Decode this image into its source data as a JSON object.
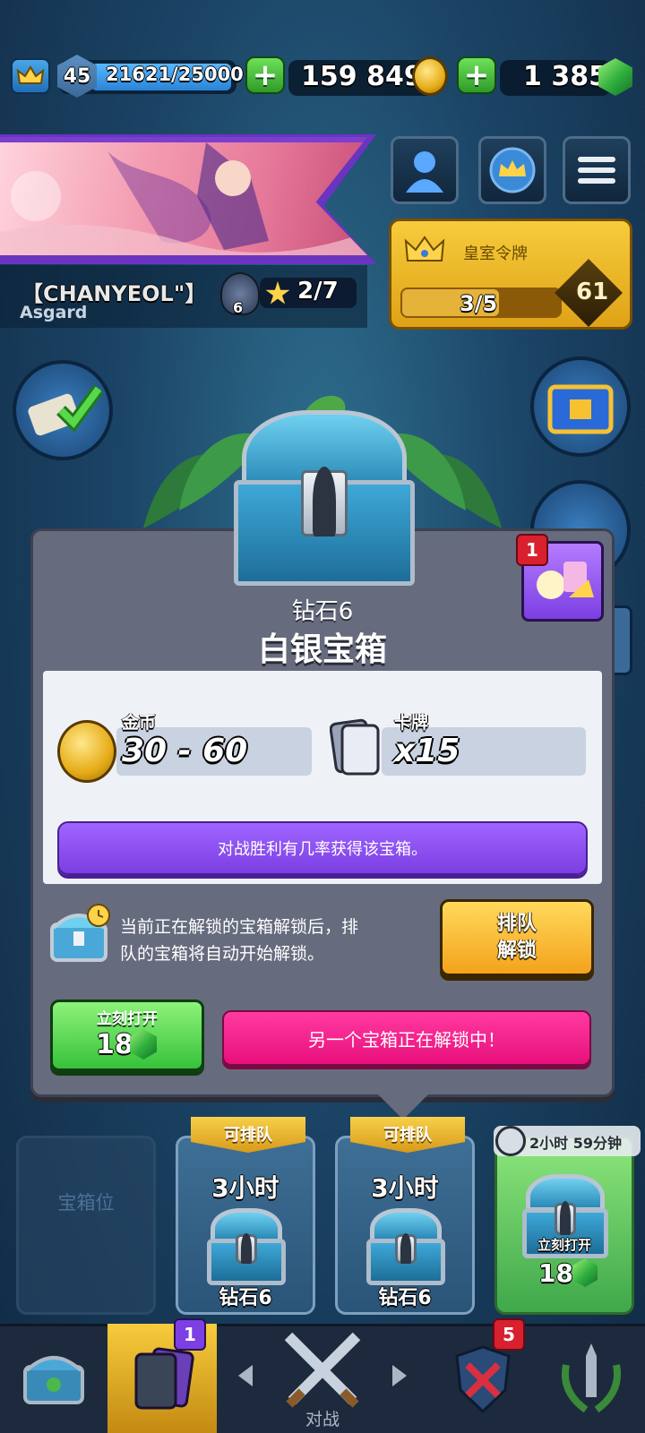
{
  "top_bar": {
    "level": "45",
    "xp": "21621/25000",
    "gold": "159 849",
    "gems": "1 385"
  },
  "profile": {
    "name": "【CHANYEOL\"】",
    "clan": "Asgard",
    "trophy_rank": "6",
    "stars": "2/7"
  },
  "royal_pass": {
    "label": "皇室令牌",
    "progress": "3/5",
    "tier": "61"
  },
  "notifications": {
    "reward_badge": "1"
  },
  "chest_popup": {
    "arena": "钻石6",
    "title": "白银宝箱",
    "gold_label": "金币",
    "gold_value": "30 - 60",
    "cards_label": "卡牌",
    "cards_value": "x15",
    "win_info": "对战胜利有几率获得该宝箱。",
    "queue_info_line1": "当前正在解锁的宝箱解锁后，排",
    "queue_info_line2": "队的宝箱将自动开始解锁。",
    "queue_button_line1": "排队",
    "queue_button_line2": "解锁",
    "open_now_label": "立刻打开",
    "open_now_cost": "18",
    "unlocking_message": "另一个宝箱正在解锁中！"
  },
  "chest_slots": [
    {
      "type": "empty",
      "label": "宝箱位"
    },
    {
      "type": "queue",
      "ribbon": "可排队",
      "time": "3小时",
      "arena": "钻石6"
    },
    {
      "type": "queue",
      "ribbon": "可排队",
      "time": "3小时",
      "arena": "钻石6"
    },
    {
      "type": "unlocking",
      "timer": "2小时 59分钟",
      "open_label": "立刻打开",
      "cost": "18"
    }
  ],
  "bottom_nav": {
    "cards_badge": "1",
    "battle_label": "对战",
    "clan_badge": "5"
  },
  "colors": {
    "panel": "#666b7d",
    "purple": "#7b3fe3",
    "pink": "#e8107c",
    "green": "#36c23a",
    "yellow": "#f4a21c"
  }
}
